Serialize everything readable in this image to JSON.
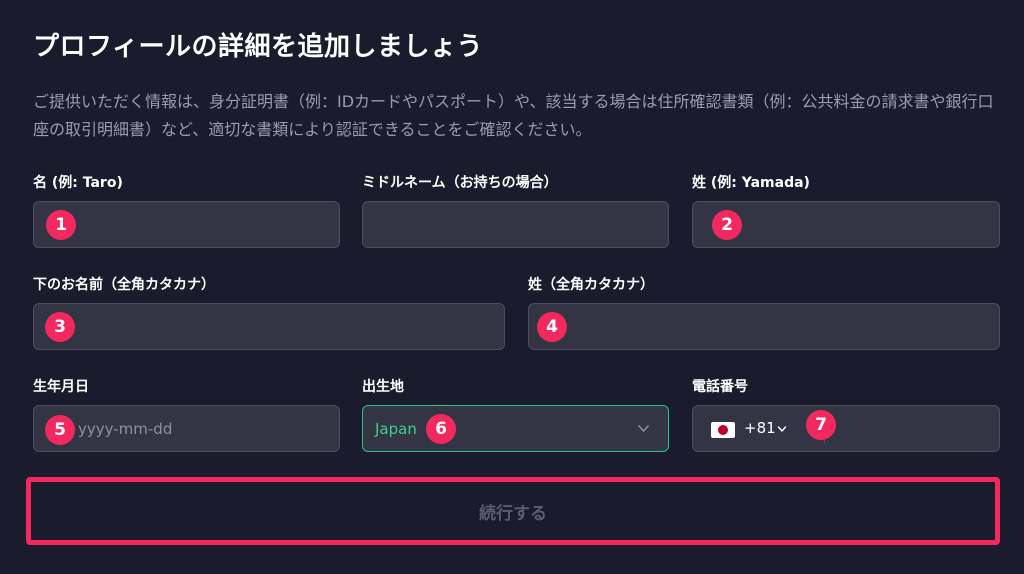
{
  "page": {
    "title": "プロフィールの詳細を追加しましょう",
    "description": "ご提供いただく情報は、身分証明書（例：IDカードやパスポート）や、該当する場合は住所確認書類（例：公共料金の請求書や銀行口座の取引明細書）など、適切な書類により認証できることをご確認ください。"
  },
  "form": {
    "first_name": {
      "label": "名 (例: Taro)",
      "value": "",
      "marker": "1"
    },
    "middle_name": {
      "label": "ミドルネーム（お持ちの場合）",
      "value": ""
    },
    "last_name": {
      "label": "姓 (例: Yamada)",
      "value": "",
      "marker": "2"
    },
    "first_name_kana": {
      "label": "下のお名前（全角カタカナ）",
      "value": "",
      "marker": "3"
    },
    "last_name_kana": {
      "label": "姓（全角カタカナ）",
      "value": "",
      "marker": "4"
    },
    "birth_date": {
      "label": "生年月日",
      "placeholder": "yyyy-mm-dd",
      "value": "",
      "marker": "5"
    },
    "birth_place": {
      "label": "出生地",
      "selected": "Japan",
      "marker": "6"
    },
    "phone": {
      "label": "電話番号",
      "country_code": "+81",
      "value": "",
      "marker": "7",
      "flag_icon": "japan-flag-icon"
    }
  },
  "actions": {
    "continue_label": "続行する"
  },
  "colors": {
    "background": "#1a1b2c",
    "field_background": "#333545",
    "marker": "#f2295f",
    "select_accent": "#3ccf8e",
    "disabled_text": "#5b5d6e"
  }
}
